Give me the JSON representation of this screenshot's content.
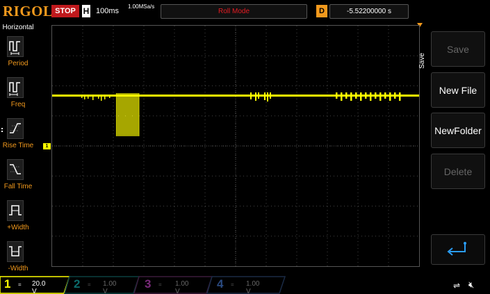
{
  "brand": "RIGOL",
  "header": {
    "run_state": "STOP",
    "timebase_label": "H",
    "timebase_value": "100ms",
    "sample_rate": "1.00MSa/s",
    "acq_mode": "Roll Mode",
    "delay_label": "D",
    "delay_value": "-5.52200000 s"
  },
  "left_menu": {
    "title": "Horizontal",
    "items": [
      {
        "label": "Period",
        "icon": "period-icon"
      },
      {
        "label": "Freq",
        "icon": "freq-icon"
      },
      {
        "label": "Rise Time",
        "icon": "rise-time-icon"
      },
      {
        "label": "Fall Time",
        "icon": "fall-time-icon"
      },
      {
        "label": "+Width",
        "icon": "positive-width-icon"
      },
      {
        "label": "-Width",
        "icon": "negative-width-icon"
      }
    ]
  },
  "right_menu": {
    "tab": "Save",
    "buttons": [
      {
        "label": "Save",
        "enabled": false
      },
      {
        "label": "New File",
        "enabled": true
      },
      {
        "label": "NewFolder",
        "enabled": true
      },
      {
        "label": "Delete",
        "enabled": false
      },
      {
        "label": "",
        "icon": "enter-icon",
        "enabled": true
      }
    ]
  },
  "channels": [
    {
      "num": "1",
      "coupling": "=",
      "scale": "20.0 V",
      "color": "#ffff00",
      "active": true
    },
    {
      "num": "2",
      "coupling": "=",
      "scale": "1.00 V",
      "color": "#00a6a6",
      "active": false
    },
    {
      "num": "3",
      "coupling": "=",
      "scale": "1.00 V",
      "color": "#c03cc0",
      "active": false
    },
    {
      "num": "4",
      "coupling": "=",
      "scale": "1.00 V",
      "color": "#2a5db0",
      "active": false
    }
  ],
  "ch1_marker": "1",
  "colors": {
    "accent": "#f39a1d",
    "ch1": "#ffff00",
    "stop": "#c0191d",
    "roll_mode": "#e51c23"
  }
}
